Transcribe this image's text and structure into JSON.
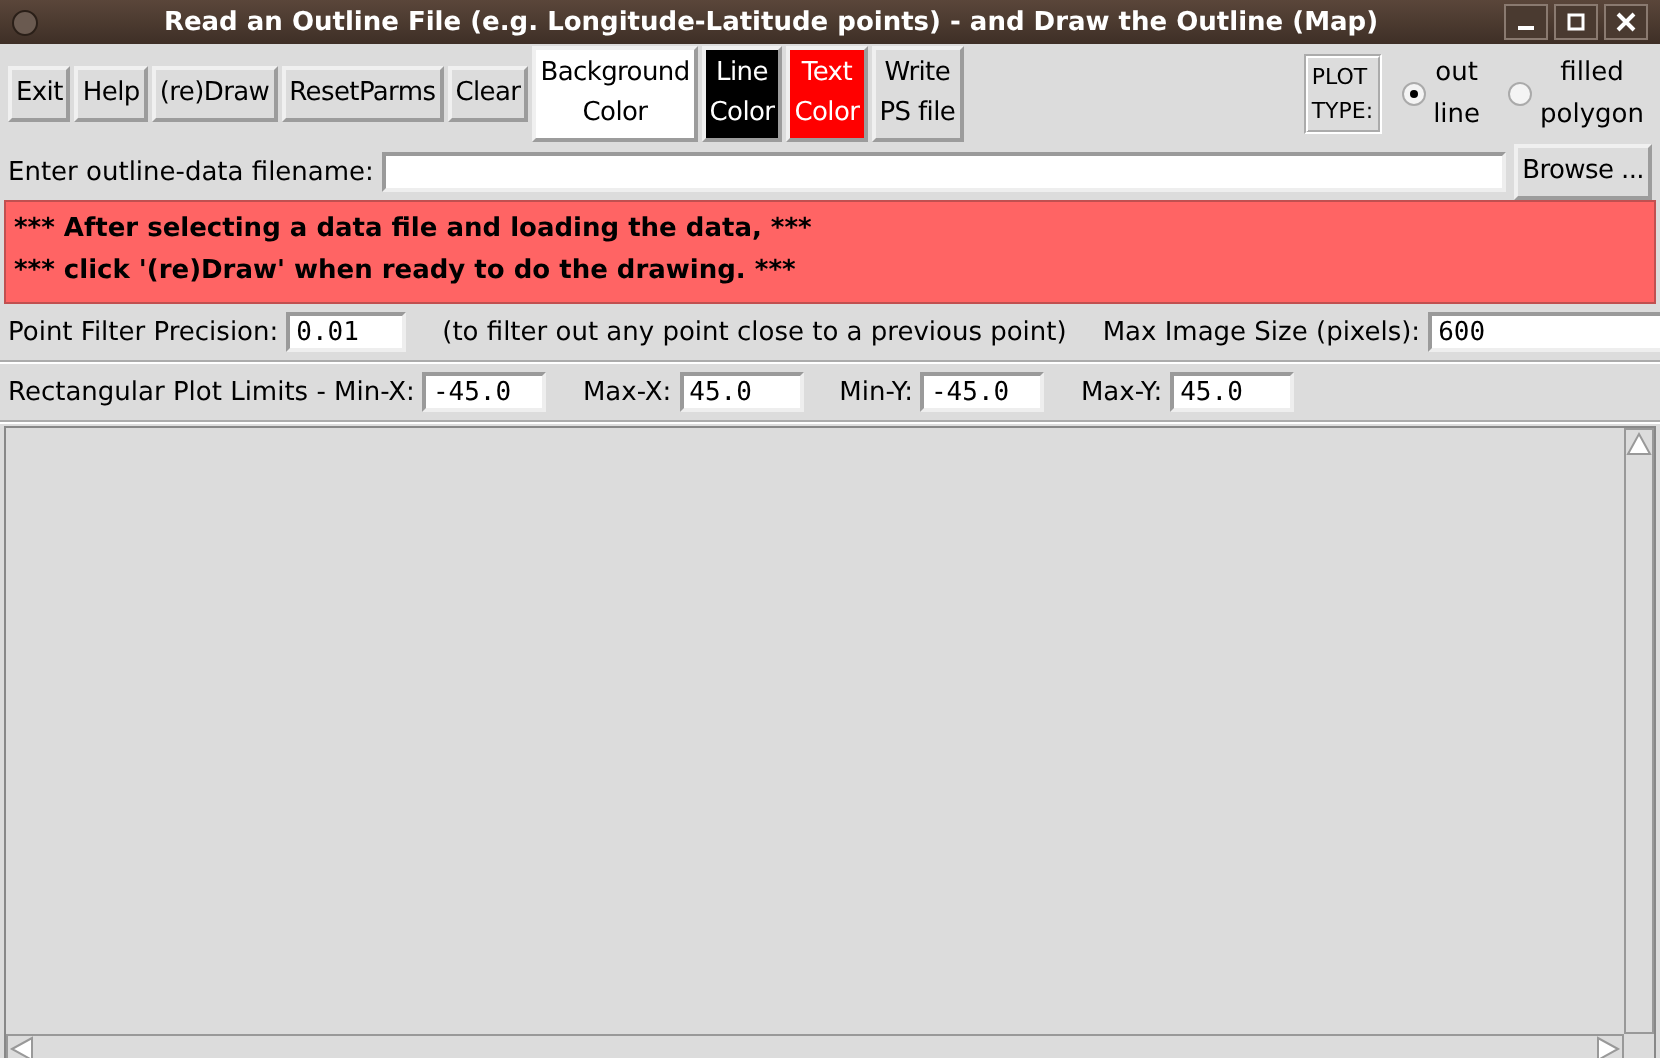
{
  "window": {
    "title": "Read an Outline File (e.g. Longitude-Latitude points) - and Draw the Outline (Map)"
  },
  "toolbar": {
    "buttons": [
      {
        "label": "Exit",
        "kind": "plain"
      },
      {
        "label": "Help",
        "kind": "plain"
      },
      {
        "label": "(re)Draw",
        "kind": "plain"
      },
      {
        "label": "ResetParms",
        "kind": "plain"
      },
      {
        "label": "Clear",
        "kind": "plain"
      },
      {
        "label": "Background\nColor",
        "kind": "color",
        "color": "#ffffff"
      },
      {
        "label": "Line\nColor",
        "kind": "color",
        "color": "#000000"
      },
      {
        "label": "Text\nColor",
        "kind": "color",
        "color": "#ff0000"
      },
      {
        "label": "Write\nPS file",
        "kind": "plain"
      }
    ],
    "plot_type": {
      "label": "PLOT\nTYPE:",
      "options": [
        {
          "label": "out\nline",
          "selected": true
        },
        {
          "label": "filled\npolygon",
          "selected": false
        }
      ]
    }
  },
  "file_row": {
    "label": "Enter outline-data filename:",
    "browse": "Browse ..."
  },
  "message": [
    "*** After selecting a data file and loading the data, ***",
    "*** click '(re)Draw' when ready to do the drawing. ***"
  ],
  "filter_row": {
    "label": "Point Filter Precision:",
    "value": "0.01",
    "note": "(to filter out any point close to a previous point)",
    "max_label": "Max Image Size (pixels):",
    "max_value": "600"
  },
  "limits_row": {
    "label": "Rectangular Plot Limits - Min-X:",
    "value": "-45.0",
    "fields": [
      {
        "label": "Max-X:",
        "value": "45.0"
      },
      {
        "label": "Min-Y:",
        "value": "-45.0"
      },
      {
        "label": "Max-Y:",
        "value": "45.0"
      }
    ]
  }
}
